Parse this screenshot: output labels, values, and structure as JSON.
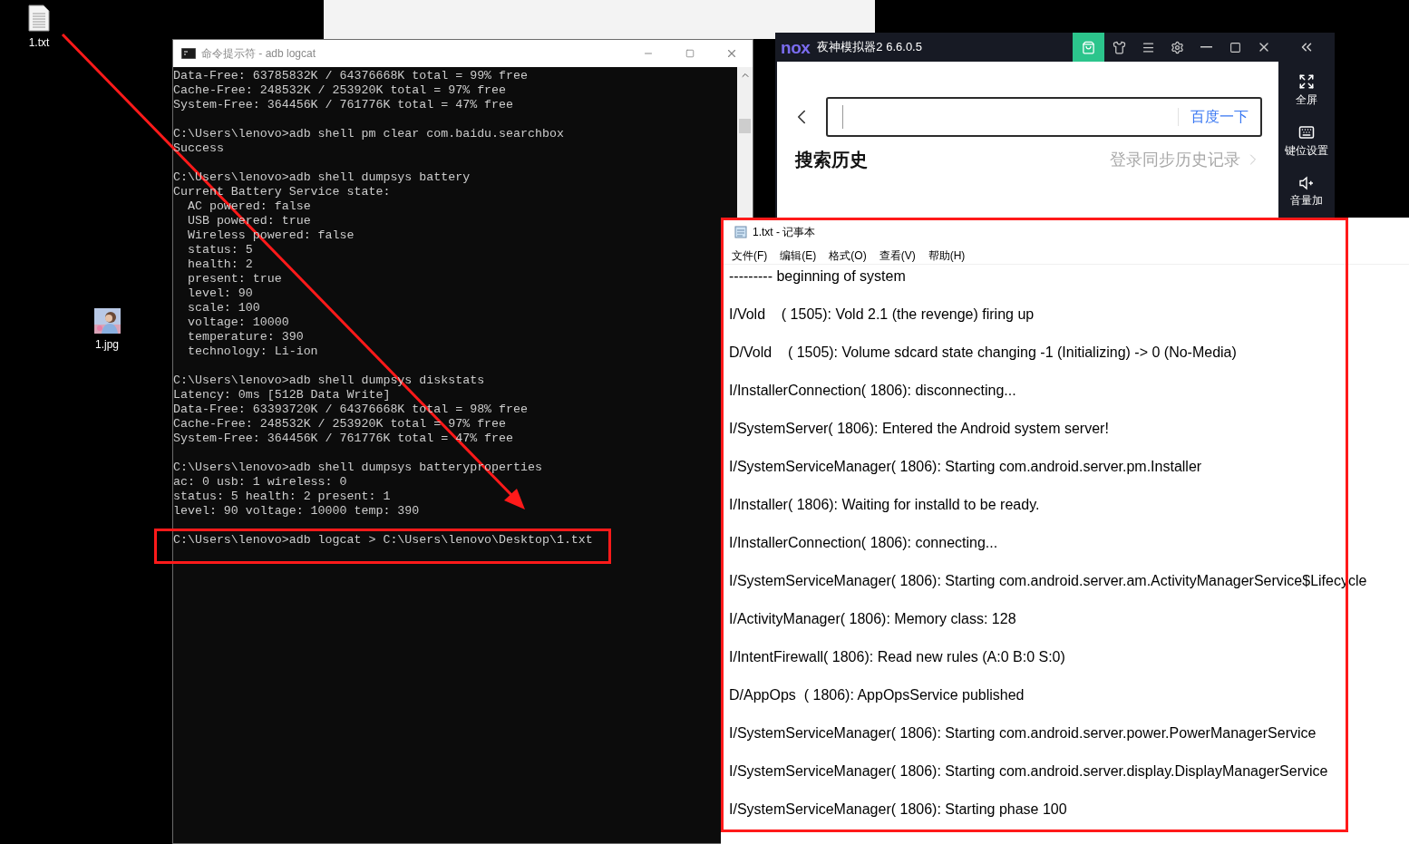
{
  "desktop_icons": [
    {
      "kind": "file",
      "label": "1.txt"
    },
    {
      "label": "1.jpg"
    }
  ],
  "cmd_window": {
    "title": "命令提示符 - adb  logcat",
    "blocks": [
      [
        "Data-Free: 63785832K / 64376668K total = 99% free",
        "Cache-Free: 248532K / 253920K total = 97% free",
        "System-Free: 364456K / 761776K total = 47% free"
      ],
      [
        "C:\\Users\\lenovo>adb shell pm clear com.baidu.searchbox",
        "Success"
      ],
      [
        "C:\\Users\\lenovo>adb shell dumpsys battery",
        "Current Battery Service state:",
        "  AC powered: false",
        "  USB powered: true",
        "  Wireless powered: false",
        "  status: 5",
        "  health: 2",
        "  present: true",
        "  level: 90",
        "  scale: 100",
        "  voltage: 10000",
        "  temperature: 390",
        "  technology: Li-ion"
      ],
      [
        "C:\\Users\\lenovo>adb shell dumpsys diskstats",
        "Latency: 0ms [512B Data Write]",
        "Data-Free: 63393720K / 64376668K total = 98% free",
        "Cache-Free: 248532K / 253920K total = 97% free",
        "System-Free: 364456K / 761776K total = 47% free"
      ],
      [
        "C:\\Users\\lenovo>adb shell dumpsys batteryproperties",
        "ac: 0 usb: 1 wireless: 0",
        "status: 5 health: 2 present: 1",
        "level: 90 voltage: 10000 temp: 390"
      ]
    ],
    "highlighted_command": "C:\\Users\\lenovo>adb logcat > C:\\Users\\lenovo\\Desktop\\1.txt"
  },
  "emulator": {
    "logo": "nox",
    "title": "夜神模拟器2 6.6.0.5",
    "search_button": "百度一下",
    "history_heading": "搜索历史",
    "sync_link": "登录同步历史记录",
    "side_tools": [
      {
        "kind": "fullscreen",
        "label": "全屏"
      },
      {
        "kind": "keymap",
        "label": "键位设置"
      },
      {
        "kind": "volume",
        "label": "音量加"
      }
    ]
  },
  "notepad": {
    "title": "1.txt - 记事本",
    "menu": [
      "文件(F)",
      "编辑(E)",
      "格式(O)",
      "查看(V)",
      "帮助(H)"
    ],
    "lines": [
      "--------- beginning of system",
      "I/Vold    ( 1505): Vold 2.1 (the revenge) firing up",
      "D/Vold    ( 1505): Volume sdcard state changing -1 (Initializing) -> 0 (No-Media)",
      "I/InstallerConnection( 1806): disconnecting...",
      "I/SystemServer( 1806): Entered the Android system server!",
      "I/SystemServiceManager( 1806): Starting com.android.server.pm.Installer",
      "I/Installer( 1806): Waiting for installd to be ready.",
      "I/InstallerConnection( 1806): connecting...",
      "I/SystemServiceManager( 1806): Starting com.android.server.am.ActivityManagerService$Lifecycle",
      "I/ActivityManager( 1806): Memory class: 128",
      "I/IntentFirewall( 1806): Read new rules (A:0 B:0 S:0)",
      "D/AppOps  ( 1806): AppOpsService published",
      "I/SystemServiceManager( 1806): Starting com.android.server.power.PowerManagerService",
      "I/SystemServiceManager( 1806): Starting com.android.server.display.DisplayManagerService",
      "I/SystemServiceManager( 1806): Starting phase 100"
    ]
  }
}
